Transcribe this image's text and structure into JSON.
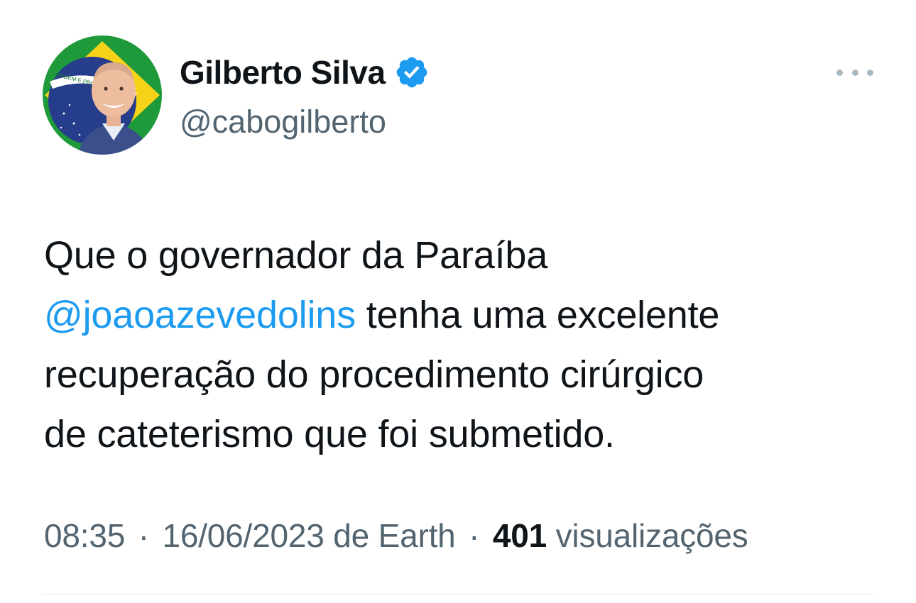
{
  "author": {
    "display_name": "Gilberto Silva",
    "handle": "@cabogilberto",
    "verified": true,
    "avatar_flag_text": "ORDEM E PROGRESSO"
  },
  "tweet": {
    "text_line1": "Que o governador da Paraíba",
    "mention": "@joaoazevedolins",
    "text_after_mention": " tenha uma excelente",
    "text_line3": "recuperação do procedimento cirúrgico",
    "text_line4": "de cateterismo que foi submetido."
  },
  "meta": {
    "time": "08:35",
    "separator": "·",
    "date": "16/06/2023",
    "source": "de Earth",
    "views_count": "401",
    "views_label": "visualizações"
  },
  "colors": {
    "accent": "#1d9bf0",
    "text_primary": "#0f1419",
    "text_secondary": "#536471"
  },
  "icons": {
    "verified": "verified-badge-icon",
    "more": "more-dots-icon"
  }
}
